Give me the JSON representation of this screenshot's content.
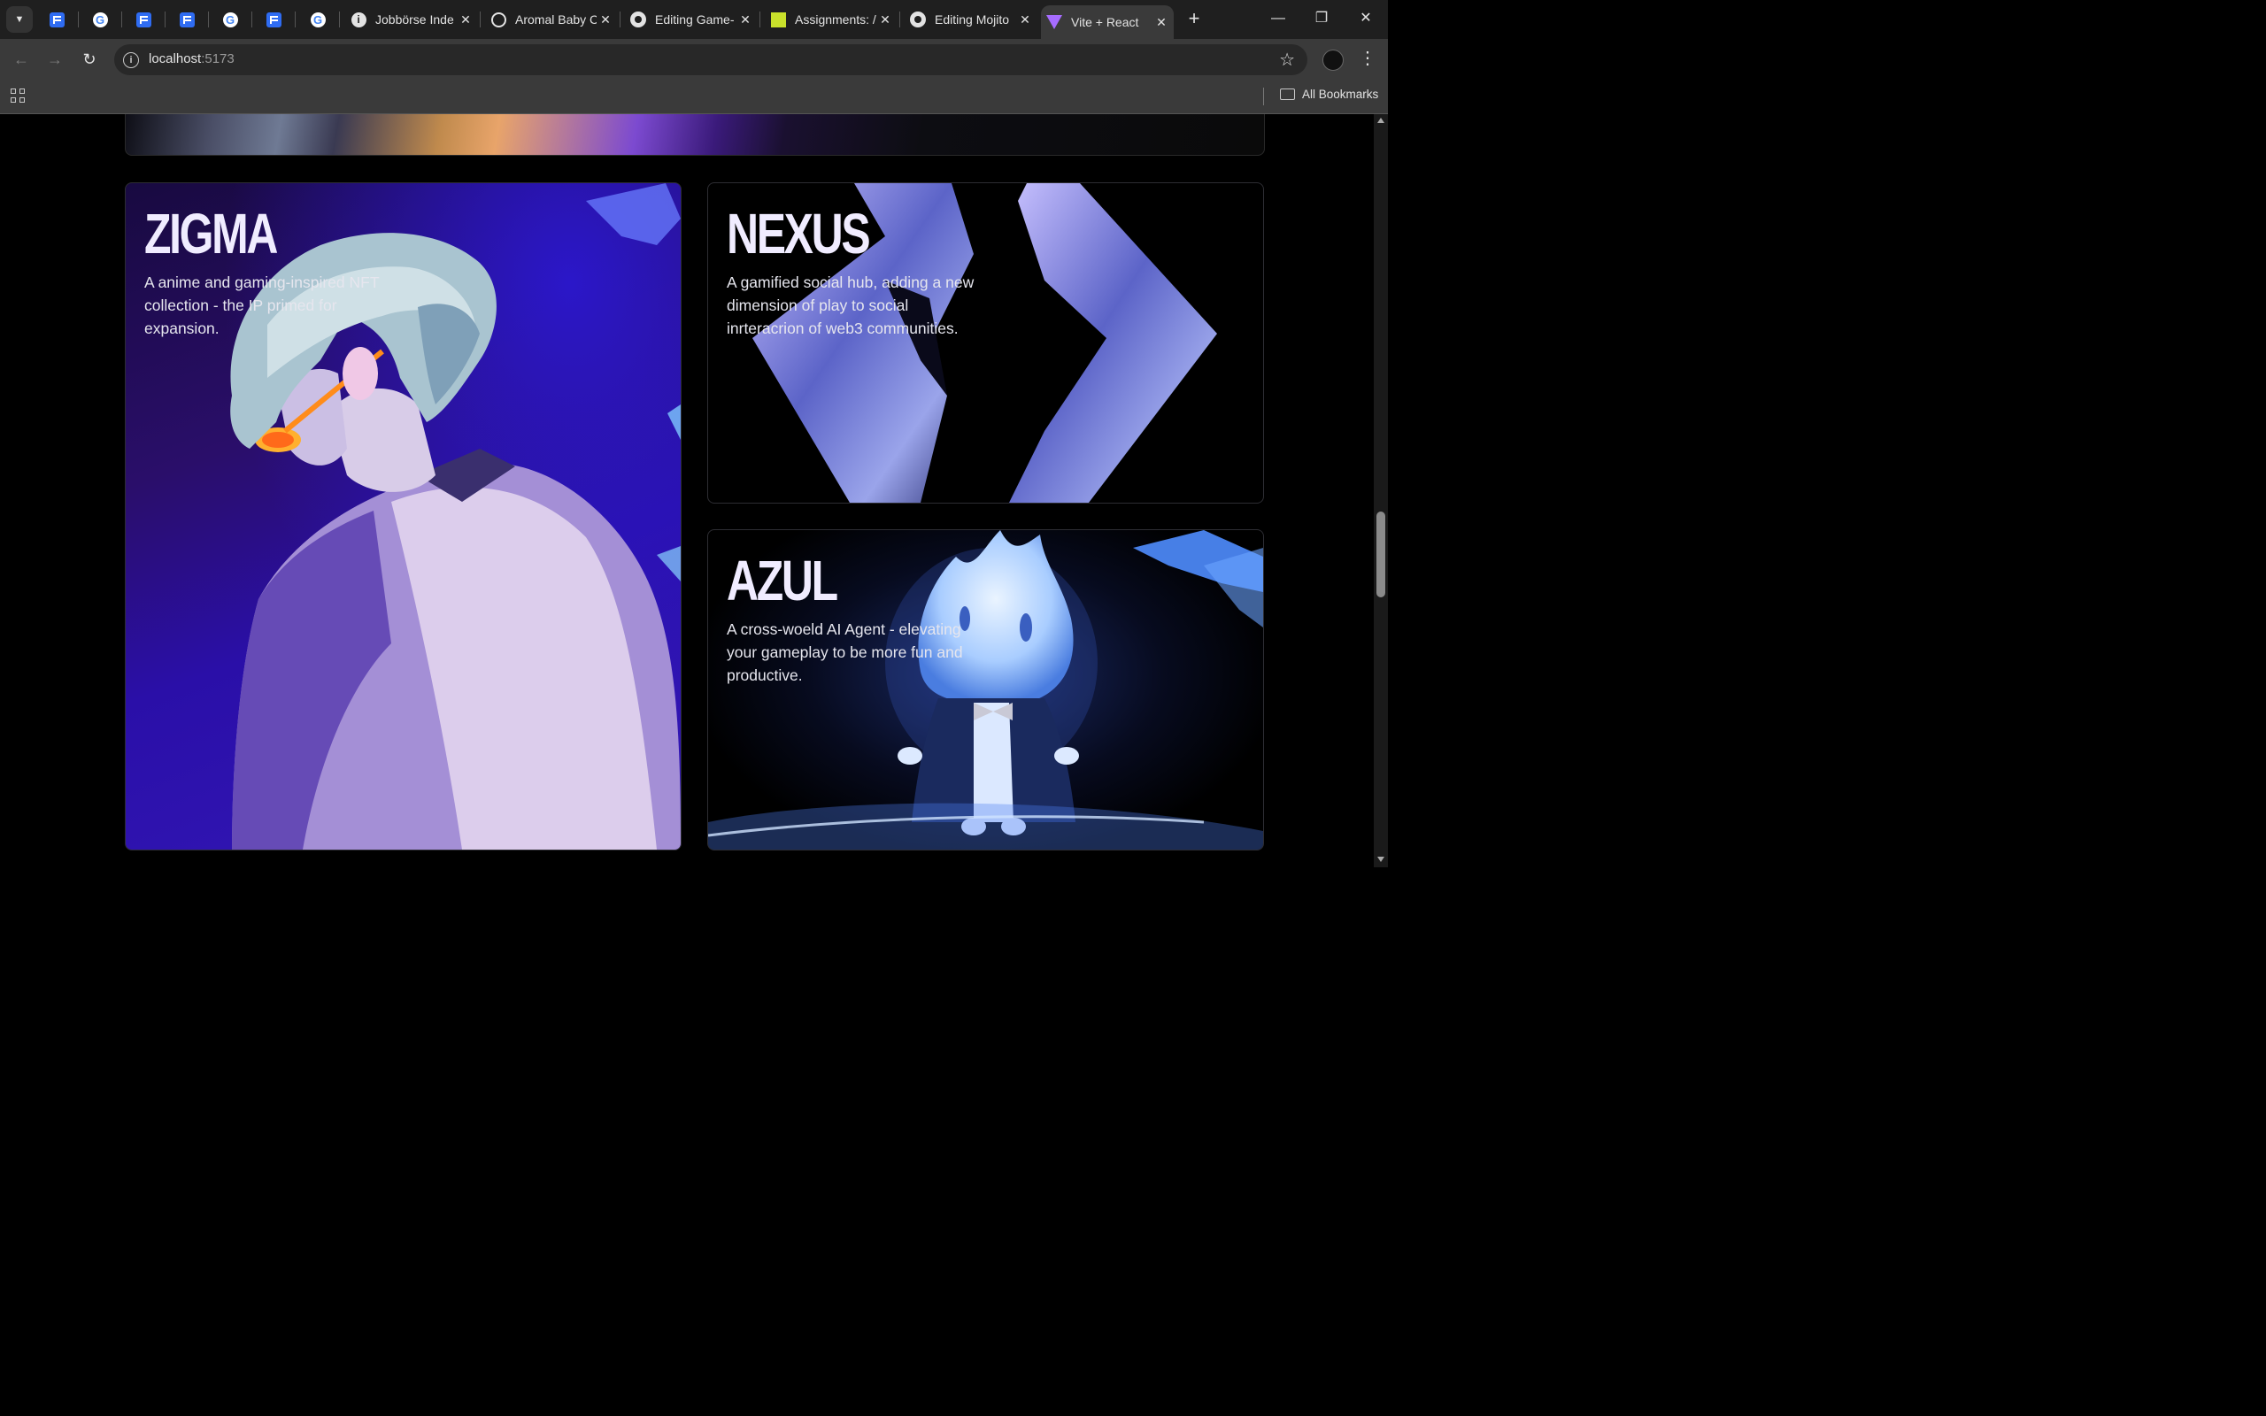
{
  "browser": {
    "tabs": [
      {
        "title": "Jobbörse Inde",
        "favicon": "info-icon"
      },
      {
        "title": "Aromal Baby C",
        "favicon": "swirl-icon"
      },
      {
        "title": "Editing Game-",
        "favicon": "github-icon"
      },
      {
        "title": "Assignments: /",
        "favicon": "assignments-icon"
      },
      {
        "title": "Editing Mojito",
        "favicon": "github-icon"
      },
      {
        "title": "Vite + React",
        "favicon": "vite-icon",
        "active": true
      }
    ],
    "pinned_tabs": [
      "docs-icon",
      "google-icon",
      "docs-icon",
      "docs-icon",
      "google-icon",
      "docs-icon",
      "google-icon"
    ],
    "url_host": "localhost",
    "url_port": ":5173",
    "bookmarks_label": "All Bookmarks"
  },
  "cards": {
    "zigma": {
      "title": "ZIGMA",
      "description": "A anime and gaming-inspired NFT collection - the IP primed for expansion."
    },
    "nexus": {
      "title": "NEXUS",
      "description": "A gamified social hub, adding a new dimension of play to social inrteracrion of web3 communities."
    },
    "azul": {
      "title": "AZUL",
      "description": "A cross-woeld AI Agent - elevating your gameplay to be more fun and productive."
    }
  },
  "colors": {
    "page_background": "#000000",
    "title_text": "#f0ecff",
    "zigma_bg": "#2a0fa8",
    "nexus_accent": "#7f8ad6",
    "azul_glow": "#9fd0ff"
  }
}
